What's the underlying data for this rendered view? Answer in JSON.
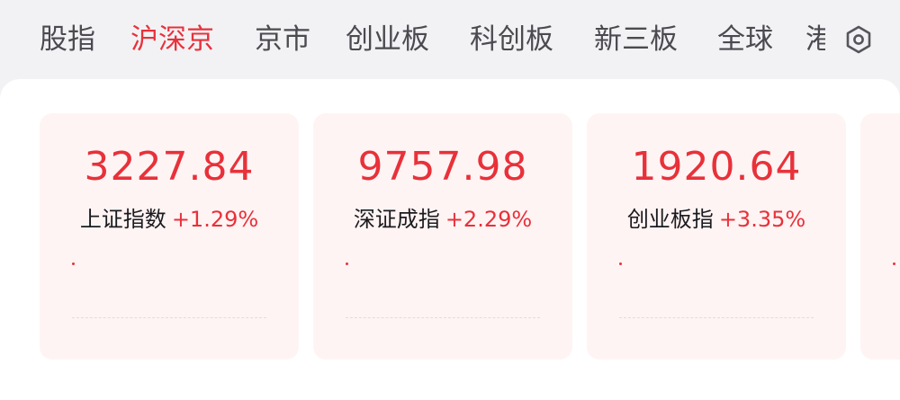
{
  "tabs": [
    {
      "label": "股指",
      "active": false
    },
    {
      "label": "沪深京",
      "active": true
    },
    {
      "label": "京市",
      "active": false
    },
    {
      "label": "创业板",
      "active": false
    },
    {
      "label": "科创板",
      "active": false
    },
    {
      "label": "新三板",
      "active": false
    },
    {
      "label": "全球",
      "active": false
    },
    {
      "label": "港",
      "active": false
    }
  ],
  "settings_icon": "gear-icon",
  "indices": [
    {
      "value": "3227.84",
      "name": "上证指数",
      "change": "+1.29%"
    },
    {
      "value": "9757.98",
      "name": "深证成指",
      "change": "+2.29%"
    },
    {
      "value": "1920.64",
      "name": "创业板指",
      "change": "+3.35%"
    }
  ],
  "colors": {
    "accent_red": "#e8313a",
    "tab_text": "#4a4a4f",
    "card_bg": "#fff4f4",
    "page_bg": "#f2f2f5"
  }
}
